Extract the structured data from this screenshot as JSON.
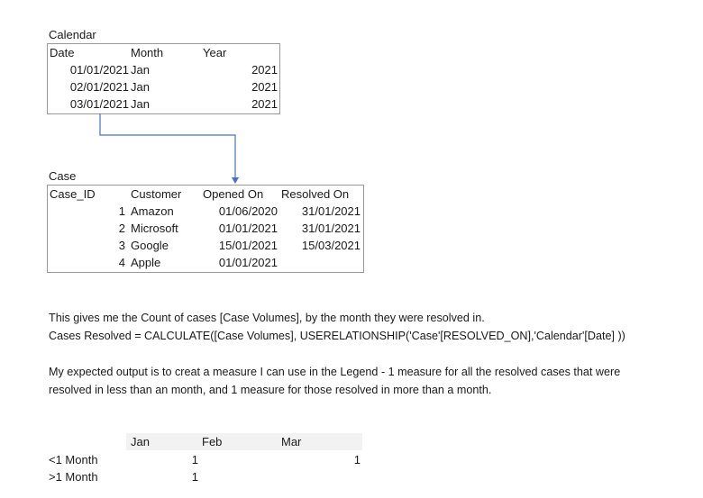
{
  "calendar": {
    "title": "Calendar",
    "headers": [
      "Date",
      "Month",
      "Year"
    ],
    "rows": [
      [
        "01/01/2021",
        "Jan",
        "2021"
      ],
      [
        "02/01/2021",
        "Jan",
        "2021"
      ],
      [
        "03/01/2021",
        "Jan",
        "2021"
      ]
    ]
  },
  "case": {
    "title": "Case",
    "headers": [
      "Case_ID",
      "Customer",
      "Opened On",
      "Resolved On"
    ],
    "rows": [
      [
        "1",
        "Amazon",
        "01/06/2020",
        "31/01/2021"
      ],
      [
        "2",
        "Microsoft",
        "01/01/2021",
        "31/01/2021"
      ],
      [
        "3",
        "Google",
        "15/01/2021",
        "15/03/2021"
      ],
      [
        "4",
        "Apple",
        "01/01/2021",
        ""
      ]
    ]
  },
  "relationship_color": "#4472c4",
  "text": {
    "line1": "This gives me the Count of cases [Case Volumes], by the month they were resolved in.",
    "line2": "Cases Resolved = CALCULATE([Case Volumes], USERELATIONSHIP('Case'[RESOLVED_ON],'Calendar'[Date] ))",
    "line3": "My expected output is to creat a measure I can use in the Legend - 1 measure for all the resolved cases that were",
    "line4": "resolved in less than an month, and 1 measure for those resolved in more than a month."
  },
  "output": {
    "headers": [
      "Jan",
      "Feb",
      "Mar"
    ],
    "rows": [
      {
        "label": "<1 Month",
        "jan": "",
        "feb": "1",
        "mar": "1"
      },
      {
        "label": ">1 Month",
        "jan": "",
        "feb": "1",
        "mar": ""
      }
    ]
  }
}
